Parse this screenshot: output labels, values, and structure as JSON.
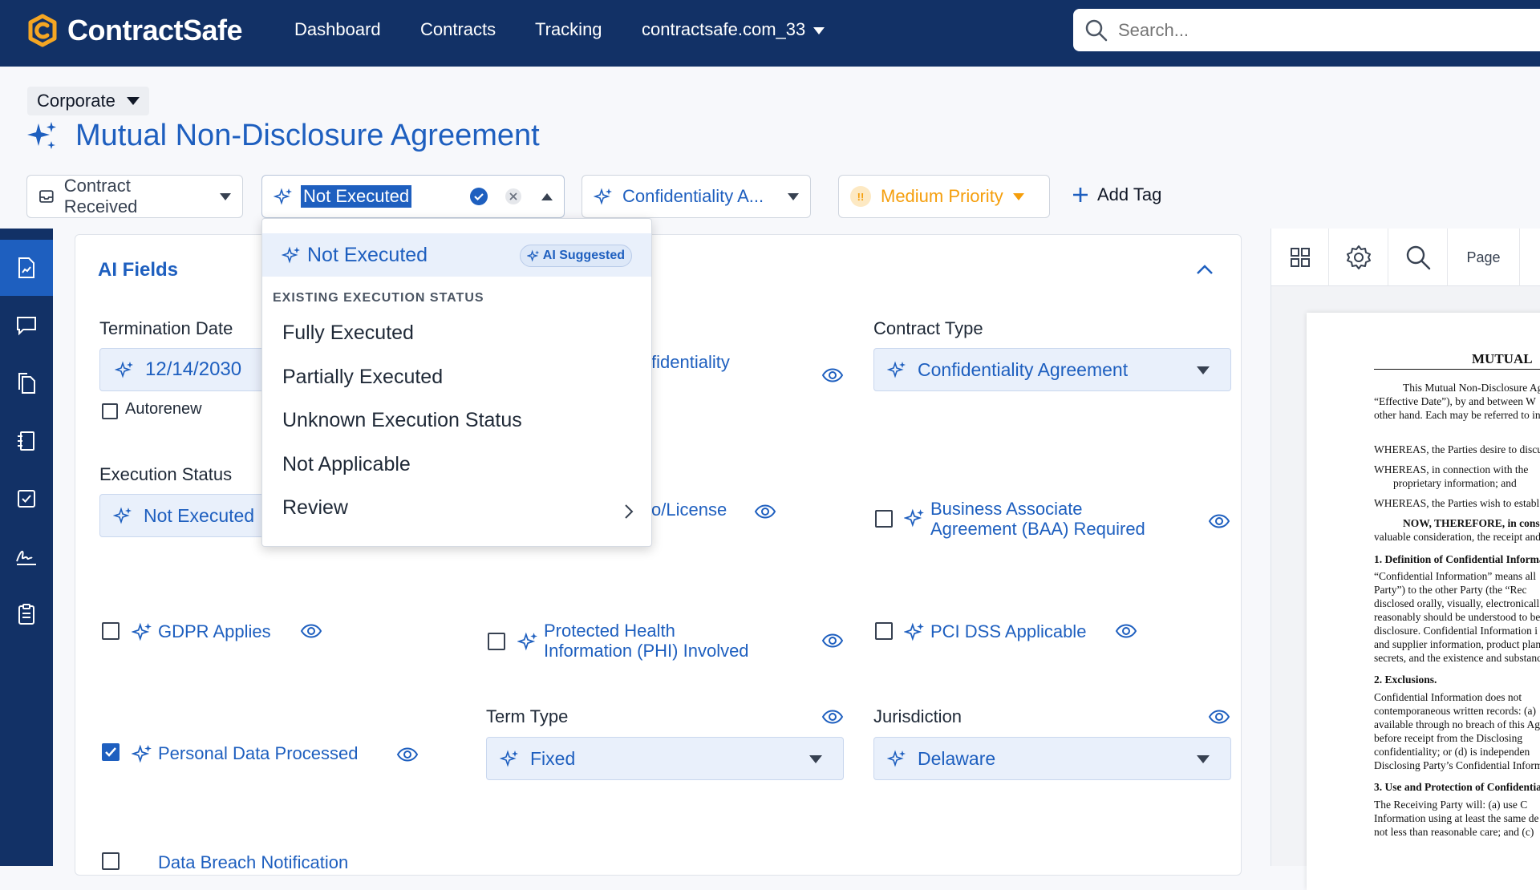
{
  "header": {
    "logo_text": "ContractSafe",
    "nav": [
      "Dashboard",
      "Contracts",
      "Tracking",
      "contractsafe.com_33"
    ],
    "search_placeholder": "Search..."
  },
  "contract": {
    "folder": "Corporate",
    "title": "Mutual Non-Disclosure Agreement"
  },
  "toolbar": {
    "stage": "Contract Received",
    "execution_status": "Not Executed",
    "type_pill": "Confidentiality A...",
    "priority": "Medium Priority",
    "priority_icon": "!!",
    "add_tag": "Add Tag"
  },
  "ai_fields": {
    "title": "AI Fields",
    "termination_date_label": "Termination Date",
    "termination_date_value": "12/14/2030",
    "autorenew_label": "Autorenew",
    "execution_status_label": "Execution Status",
    "execution_status_value": "Not Executed",
    "partial_confidentiality": "fidentiality",
    "partial_license": "o/License",
    "contract_type_label": "Contract Type",
    "contract_type_value": "Confidentiality Agreement",
    "baa_line1": "Business Associate",
    "baa_line2": "Agreement (BAA) Required",
    "gdpr": "GDPR Applies",
    "phi_line1": "Protected Health",
    "phi_line2": "Information (PHI) Involved",
    "pci": "PCI DSS Applicable",
    "personal_data": "Personal Data Processed",
    "term_type_label": "Term Type",
    "term_type_value": "Fixed",
    "jurisdiction_label": "Jurisdiction",
    "jurisdiction_value": "Delaware",
    "data_breach": "Data Breach Notification"
  },
  "dropdown": {
    "suggested": "Not Executed",
    "badge": "AI Suggested",
    "section_header": "EXISTING EXECUTION STATUS",
    "options": [
      "Fully Executed",
      "Partially Executed",
      "Unknown Execution Status",
      "Not Applicable",
      "Review"
    ]
  },
  "viewer": {
    "page_label": "Page",
    "doc_lines": [
      "MUTUAL",
      "This Mutual Non-Disclosure Ag",
      "“Effective Date”), by and between W",
      "other hand. Each may be referred to in",
      "WHEREAS, the Parties desire to discu",
      "WHEREAS, in connection with the",
      "proprietary information; and",
      "WHEREAS, the Parties wish to establ",
      "NOW, THEREFORE, in cons",
      "valuable consideration, the receipt and",
      "1. Definition of Confidential Informa",
      "“Confidential Information” means all",
      "Party”) to the other Party (the “Rec",
      "disclosed orally, visually, electronicall",
      "reasonably should be understood to be",
      "disclosure. Confidential Information i",
      "and supplier information, product plan",
      "secrets, and the existence and substanc",
      "2. Exclusions.",
      "Confidential Information does not",
      "contemporaneous written records: (a)",
      "available through no breach of this Ag",
      "before receipt from the Disclosing",
      "confidentiality; or (d) is independen",
      "Disclosing Party’s Confidential Inform",
      "3. Use and Protection of Confidentia",
      "The Receiving Party will: (a) use C",
      "Information using at least the same de",
      "not less than reasonable care; and (c)"
    ]
  },
  "colors": {
    "nav_bg": "#123166",
    "accent": "#1e5fbf",
    "priority": "#f59e0b"
  }
}
